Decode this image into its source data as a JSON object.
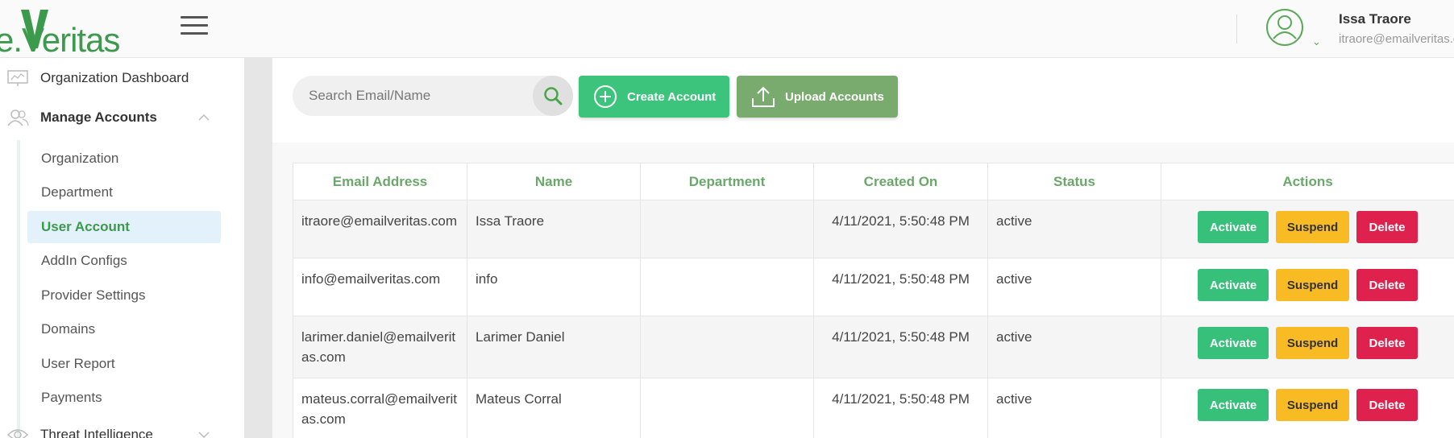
{
  "header": {
    "logo_text": "e.Veritas",
    "user_name": "Issa Traore",
    "user_email": "itraore@emailveritas.com"
  },
  "sidebar": {
    "items": [
      {
        "label": "Organization Dashboard",
        "icon": "dashboard-icon"
      },
      {
        "label": "Manage Accounts",
        "icon": "users-icon"
      },
      {
        "label": "Threat Intelligence",
        "icon": "eye-icon"
      }
    ],
    "sub_items": [
      {
        "label": "Organization"
      },
      {
        "label": "Department"
      },
      {
        "label": "User Account"
      },
      {
        "label": "AddIn Configs"
      },
      {
        "label": "Provider Settings"
      },
      {
        "label": "Domains"
      },
      {
        "label": "User Report"
      },
      {
        "label": "Payments"
      }
    ],
    "active_sub_item": "User Account"
  },
  "toolbar": {
    "search_placeholder": "Search Email/Name",
    "create_label": "Create Account",
    "upload_label": "Upload Accounts"
  },
  "table": {
    "headers": [
      "Email Address",
      "Name",
      "Department",
      "Created On",
      "Status",
      "Actions"
    ],
    "rows": [
      {
        "email": "itraore@emailveritas.com",
        "name": "Issa Traore",
        "department": "",
        "created": "4/11/2021, 5:50:48 PM",
        "status": "active"
      },
      {
        "email": "info@emailveritas.com",
        "name": "info",
        "department": "",
        "created": "4/11/2021, 5:50:48 PM",
        "status": "active"
      },
      {
        "email": "larimer.daniel@emailveritas.com",
        "name": "Larimer Daniel",
        "department": "",
        "created": "4/11/2021, 5:50:48 PM",
        "status": "active"
      },
      {
        "email": "mateus.corral@emailveritas.com",
        "name": "Mateus Corral",
        "department": "",
        "created": "4/11/2021, 5:50:48 PM",
        "status": "active"
      }
    ],
    "action_labels": {
      "activate": "Activate",
      "suspend": "Suspend",
      "delete": "Delete"
    }
  },
  "colors": {
    "brand_green": "#3b9a4c",
    "create_button": "#3cc47c",
    "upload_button": "#7aab6e",
    "activate": "#36c07a",
    "suspend": "#f9bb24",
    "delete": "#df214e"
  }
}
